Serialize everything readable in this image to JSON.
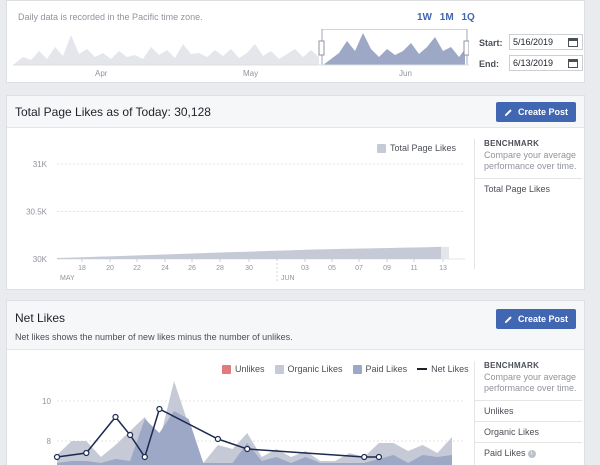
{
  "timeline": {
    "tz_note": "Daily data is recorded in the Pacific time zone.",
    "ranges": [
      "1W",
      "1M",
      "1Q"
    ],
    "months": [
      "Apr",
      "May",
      "Jun"
    ],
    "start_label": "Start:",
    "start_value": "5/16/2019",
    "end_label": "End:",
    "end_value": "6/13/2019"
  },
  "page_likes": {
    "title": "Total Page Likes as of Today: 30,128",
    "create_post": "Create Post",
    "legend": "Total Page Likes",
    "benchmark_title": "BENCHMARK",
    "benchmark_sub": "Compare your average performance over time.",
    "benchmark_items": [
      "Total Page Likes"
    ]
  },
  "net_likes": {
    "title": "Net Likes",
    "subtitle": "Net likes shows the number of new likes minus the number of unlikes.",
    "create_post": "Create Post",
    "legend": [
      "Unlikes",
      "Organic Likes",
      "Paid Likes",
      "Net Likes"
    ],
    "benchmark_title": "BENCHMARK",
    "benchmark_sub": "Compare your average performance over time.",
    "benchmark_items": [
      "Unlikes",
      "Organic Likes",
      "Paid Likes"
    ],
    "paid_info_icon": "i"
  },
  "colors": {
    "accent": "#4267b2",
    "unlikes": "#e07b7b",
    "organic": "#c6cad6",
    "paid": "#9ca8c6",
    "net": "#1d2b4f"
  },
  "chart_data": [
    {
      "type": "area",
      "title": "Total Page Likes as of Today: 30,128",
      "series": [
        {
          "name": "Total Page Likes",
          "values": [
            30010,
            30015,
            30020,
            30025,
            30030,
            30035,
            30040,
            30045,
            30050,
            30055,
            30060,
            30065,
            30070,
            30075,
            30080,
            30085,
            30090,
            30095,
            30100,
            30103,
            30106,
            30109,
            30112,
            30115,
            30118,
            30121,
            30124,
            30128
          ]
        }
      ],
      "x_ticks": [
        "18",
        "20",
        "22",
        "24",
        "26",
        "28",
        "30",
        "03",
        "05",
        "07",
        "09",
        "11",
        "13"
      ],
      "x_groups": [
        "MAY",
        "JUN"
      ],
      "y_ticks": [
        "31K",
        "30.5K",
        "30K"
      ],
      "ylim": [
        30000,
        31000
      ]
    },
    {
      "type": "area",
      "title": "Net Likes",
      "y_ticks": [
        "10",
        "8"
      ],
      "ylim": [
        6.5,
        11
      ],
      "series": [
        {
          "name": "Organic Likes",
          "values": [
            7.3,
            8,
            8,
            7.2,
            7.8,
            8.5,
            9.2,
            8,
            11,
            8.8,
            6.9,
            7.8,
            7.6,
            8.4,
            7.2,
            7.6,
            7.2,
            7.5,
            7,
            7,
            7.4,
            7.2,
            7.9,
            7.9,
            7.5,
            7.8,
            7.4,
            8.2
          ]
        },
        {
          "name": "Paid Likes",
          "values": [
            6.9,
            7,
            7,
            6.9,
            7.1,
            7,
            9.1,
            8.4,
            9.5,
            9.1,
            6.9,
            6.9,
            6.9,
            7.9,
            7,
            7.2,
            6.9,
            7.2,
            6.9,
            6.9,
            6.9,
            6.9,
            7.1,
            7.3,
            6.9,
            7.3,
            7.2,
            7.3
          ]
        },
        {
          "name": "Net Likes",
          "values": [
            7.2,
            null,
            7.4,
            null,
            9.2,
            8.3,
            7.2,
            9.6,
            null,
            null,
            null,
            8.1,
            null,
            7.6,
            null,
            null,
            null,
            null,
            null,
            null,
            null,
            7.2,
            7.2,
            null,
            null,
            null,
            null,
            null
          ]
        }
      ]
    }
  ]
}
